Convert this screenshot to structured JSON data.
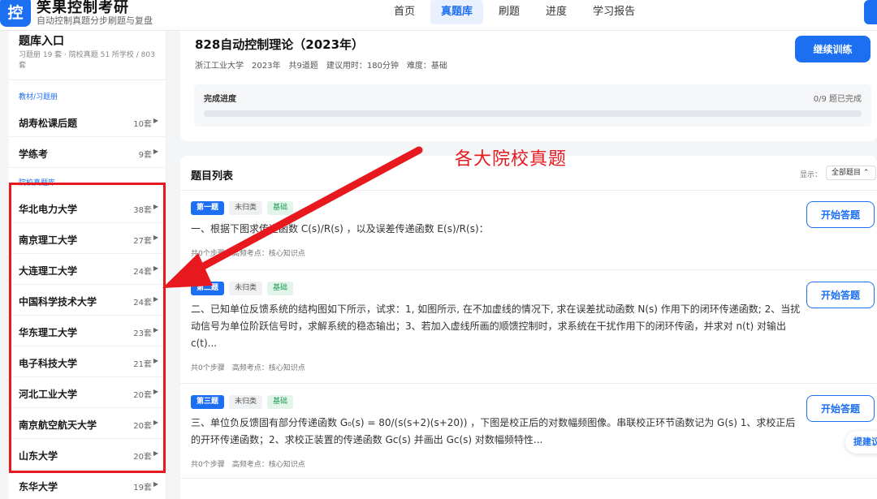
{
  "header": {
    "logo_char": "控",
    "brand_name": "笑果控制考研",
    "brand_sub": "自动控制真题分步刷题与复盘",
    "nav": [
      {
        "label": "首页"
      },
      {
        "label": "真题库"
      },
      {
        "label": "刷题"
      },
      {
        "label": "进度"
      },
      {
        "label": "学习报告"
      }
    ],
    "active_nav": "真题库"
  },
  "sidebar": {
    "title": "题库入口",
    "desc": "习题册 19 套 · 院校真题 51 所学校 / 803 套",
    "section_textbook": "教材/习题册",
    "section_school": "院校真题库",
    "textbooks": [
      {
        "name": "胡寿松课后题",
        "count": "10套"
      },
      {
        "name": "学练考",
        "count": "9套"
      }
    ],
    "schools": [
      {
        "name": "华北电力大学",
        "count": "38套"
      },
      {
        "name": "南京理工大学",
        "count": "27套"
      },
      {
        "name": "大连理工大学",
        "count": "24套"
      },
      {
        "name": "中国科学技术大学",
        "count": "24套"
      },
      {
        "name": "华东理工大学",
        "count": "23套"
      },
      {
        "name": "电子科技大学",
        "count": "21套"
      },
      {
        "name": "河北工业大学",
        "count": "20套"
      },
      {
        "name": "南京航空航天大学",
        "count": "20套"
      },
      {
        "name": "山东大学",
        "count": "20套"
      },
      {
        "name": "东华大学",
        "count": "19套"
      }
    ]
  },
  "paper": {
    "title": "828自动控制理论（2023年）",
    "school": "浙江工业大学",
    "year": "2023年",
    "total": "共9道题",
    "time": "建议用时：180分钟",
    "difficulty": "难度：基础",
    "continue_label": "继续训练",
    "progress_label": "完成进度",
    "progress_text": "0/9 题已完成",
    "progress_fraction": 0
  },
  "annotation": {
    "text": "各大院校真题",
    "color": "#e8191e"
  },
  "list": {
    "title": "题目列表",
    "filter_label": "显示：",
    "filter_value": "全部题目 ⌃",
    "questions": [
      {
        "num": "第一题",
        "category": "未归类",
        "level": "基础",
        "text": "一、根据下图求传递函数 C(s)/R(s) ，以及误差传递函数 E(s)/R(s)：",
        "meta": "共0个步骤　高频考点：核心知识点",
        "button": "开始答题"
      },
      {
        "num": "第二题",
        "category": "未归类",
        "level": "基础",
        "text": "二、已知单位反馈系统的结构图如下所示，试求：1, 如图所示, 在不加虚线的情况下, 求在误差扰动函数 N(s) 作用下的闭环传递函数; 2、当扰动信号为单位阶跃信号时，求解系统的稳态输出；3、若加入虚线所画的顺馈控制时，求系统在干扰作用下的闭环传函，并求对 n(t) 对输出 c(t)...",
        "meta": "共0个步骤　高频考点：核心知识点",
        "button": "开始答题"
      },
      {
        "num": "第三题",
        "category": "未归类",
        "level": "基础",
        "text": "三、单位负反馈固有部分传递函数 G₀(s) = 80/(s(s+2)(s+20)) ，下图是校正后的对数幅频图像。串联校正环节函数记为 G(s) 1、求校正后的开环传递函数；2、求校正装置的传递函数 Gc(s) 并画出 Gc(s) 对数幅频特性...",
        "meta": "共0个步骤　高频考点：核心知识点",
        "button": "开始答题"
      }
    ]
  },
  "suggest_label": "提建议",
  "colors": {
    "accent": "#1d6ff2",
    "annotation": "#e8191e"
  }
}
